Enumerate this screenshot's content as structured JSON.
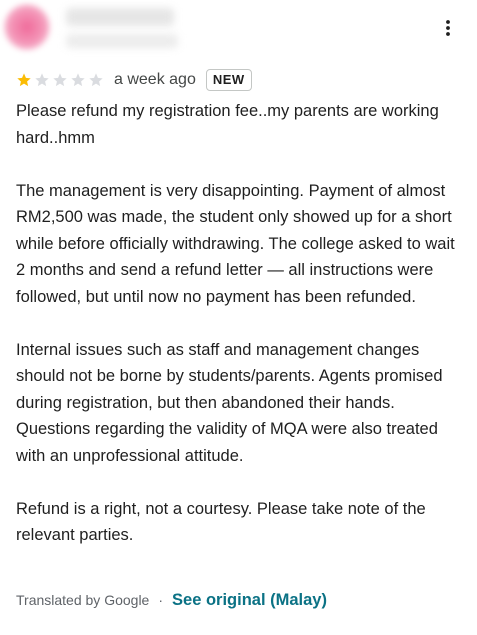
{
  "review": {
    "rating": 1,
    "max_rating": 5,
    "date": "a week ago",
    "badge": "NEW",
    "paragraphs": [
      "Please refund my registration fee..my parents are working hard..hmm",
      "The management is very disappointing. Payment of almost RM2,500 was made, the student only showed up for a short while before officially withdrawing. The college asked to wait 2 months and send a refund letter — all instructions were followed, but until now no payment has been refunded.",
      "Internal issues such as staff and management changes should not be borne by students/parents. Agents promised during registration, but then abandoned their hands. Questions regarding the validity of MQA were also treated with an unprofessional attitude.",
      "Refund is a right, not a courtesy. Please take note of the relevant parties."
    ]
  },
  "footer": {
    "translated_by": "Translated by Google",
    "separator": "·",
    "see_original": "See original (Malay)"
  },
  "icons": {
    "more": "more-vert-icon",
    "star_filled": "star-filled-icon",
    "star_empty": "star-empty-icon"
  },
  "colors": {
    "star_filled": "#fbbc04",
    "star_empty": "#dadce0",
    "link": "#0b7285",
    "text": "#1f1f1f",
    "secondary": "#5f6368"
  }
}
